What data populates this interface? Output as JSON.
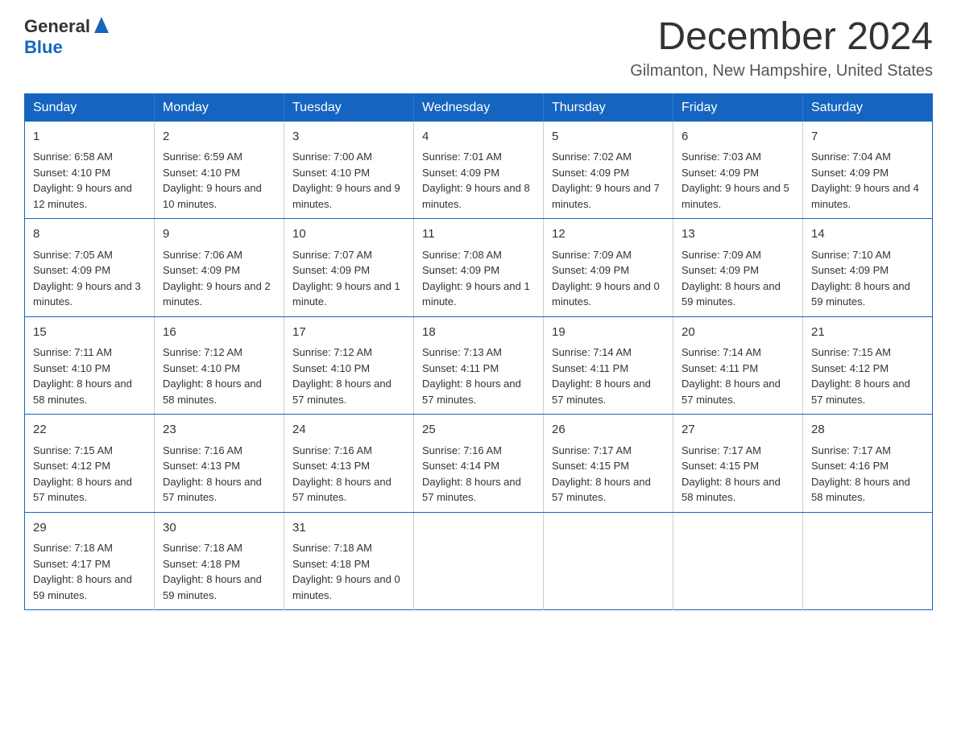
{
  "header": {
    "logo_general": "General",
    "logo_blue": "Blue",
    "month": "December 2024",
    "location": "Gilmanton, New Hampshire, United States"
  },
  "weekdays": [
    "Sunday",
    "Monday",
    "Tuesday",
    "Wednesday",
    "Thursday",
    "Friday",
    "Saturday"
  ],
  "weeks": [
    [
      {
        "day": "1",
        "sunrise": "6:58 AM",
        "sunset": "4:10 PM",
        "daylight": "9 hours and 12 minutes."
      },
      {
        "day": "2",
        "sunrise": "6:59 AM",
        "sunset": "4:10 PM",
        "daylight": "9 hours and 10 minutes."
      },
      {
        "day": "3",
        "sunrise": "7:00 AM",
        "sunset": "4:10 PM",
        "daylight": "9 hours and 9 minutes."
      },
      {
        "day": "4",
        "sunrise": "7:01 AM",
        "sunset": "4:09 PM",
        "daylight": "9 hours and 8 minutes."
      },
      {
        "day": "5",
        "sunrise": "7:02 AM",
        "sunset": "4:09 PM",
        "daylight": "9 hours and 7 minutes."
      },
      {
        "day": "6",
        "sunrise": "7:03 AM",
        "sunset": "4:09 PM",
        "daylight": "9 hours and 5 minutes."
      },
      {
        "day": "7",
        "sunrise": "7:04 AM",
        "sunset": "4:09 PM",
        "daylight": "9 hours and 4 minutes."
      }
    ],
    [
      {
        "day": "8",
        "sunrise": "7:05 AM",
        "sunset": "4:09 PM",
        "daylight": "9 hours and 3 minutes."
      },
      {
        "day": "9",
        "sunrise": "7:06 AM",
        "sunset": "4:09 PM",
        "daylight": "9 hours and 2 minutes."
      },
      {
        "day": "10",
        "sunrise": "7:07 AM",
        "sunset": "4:09 PM",
        "daylight": "9 hours and 1 minute."
      },
      {
        "day": "11",
        "sunrise": "7:08 AM",
        "sunset": "4:09 PM",
        "daylight": "9 hours and 1 minute."
      },
      {
        "day": "12",
        "sunrise": "7:09 AM",
        "sunset": "4:09 PM",
        "daylight": "9 hours and 0 minutes."
      },
      {
        "day": "13",
        "sunrise": "7:09 AM",
        "sunset": "4:09 PM",
        "daylight": "8 hours and 59 minutes."
      },
      {
        "day": "14",
        "sunrise": "7:10 AM",
        "sunset": "4:09 PM",
        "daylight": "8 hours and 59 minutes."
      }
    ],
    [
      {
        "day": "15",
        "sunrise": "7:11 AM",
        "sunset": "4:10 PM",
        "daylight": "8 hours and 58 minutes."
      },
      {
        "day": "16",
        "sunrise": "7:12 AM",
        "sunset": "4:10 PM",
        "daylight": "8 hours and 58 minutes."
      },
      {
        "day": "17",
        "sunrise": "7:12 AM",
        "sunset": "4:10 PM",
        "daylight": "8 hours and 57 minutes."
      },
      {
        "day": "18",
        "sunrise": "7:13 AM",
        "sunset": "4:11 PM",
        "daylight": "8 hours and 57 minutes."
      },
      {
        "day": "19",
        "sunrise": "7:14 AM",
        "sunset": "4:11 PM",
        "daylight": "8 hours and 57 minutes."
      },
      {
        "day": "20",
        "sunrise": "7:14 AM",
        "sunset": "4:11 PM",
        "daylight": "8 hours and 57 minutes."
      },
      {
        "day": "21",
        "sunrise": "7:15 AM",
        "sunset": "4:12 PM",
        "daylight": "8 hours and 57 minutes."
      }
    ],
    [
      {
        "day": "22",
        "sunrise": "7:15 AM",
        "sunset": "4:12 PM",
        "daylight": "8 hours and 57 minutes."
      },
      {
        "day": "23",
        "sunrise": "7:16 AM",
        "sunset": "4:13 PM",
        "daylight": "8 hours and 57 minutes."
      },
      {
        "day": "24",
        "sunrise": "7:16 AM",
        "sunset": "4:13 PM",
        "daylight": "8 hours and 57 minutes."
      },
      {
        "day": "25",
        "sunrise": "7:16 AM",
        "sunset": "4:14 PM",
        "daylight": "8 hours and 57 minutes."
      },
      {
        "day": "26",
        "sunrise": "7:17 AM",
        "sunset": "4:15 PM",
        "daylight": "8 hours and 57 minutes."
      },
      {
        "day": "27",
        "sunrise": "7:17 AM",
        "sunset": "4:15 PM",
        "daylight": "8 hours and 58 minutes."
      },
      {
        "day": "28",
        "sunrise": "7:17 AM",
        "sunset": "4:16 PM",
        "daylight": "8 hours and 58 minutes."
      }
    ],
    [
      {
        "day": "29",
        "sunrise": "7:18 AM",
        "sunset": "4:17 PM",
        "daylight": "8 hours and 59 minutes."
      },
      {
        "day": "30",
        "sunrise": "7:18 AM",
        "sunset": "4:18 PM",
        "daylight": "8 hours and 59 minutes."
      },
      {
        "day": "31",
        "sunrise": "7:18 AM",
        "sunset": "4:18 PM",
        "daylight": "9 hours and 0 minutes."
      },
      null,
      null,
      null,
      null
    ]
  ],
  "labels": {
    "sunrise": "Sunrise:",
    "sunset": "Sunset:",
    "daylight": "Daylight:"
  }
}
